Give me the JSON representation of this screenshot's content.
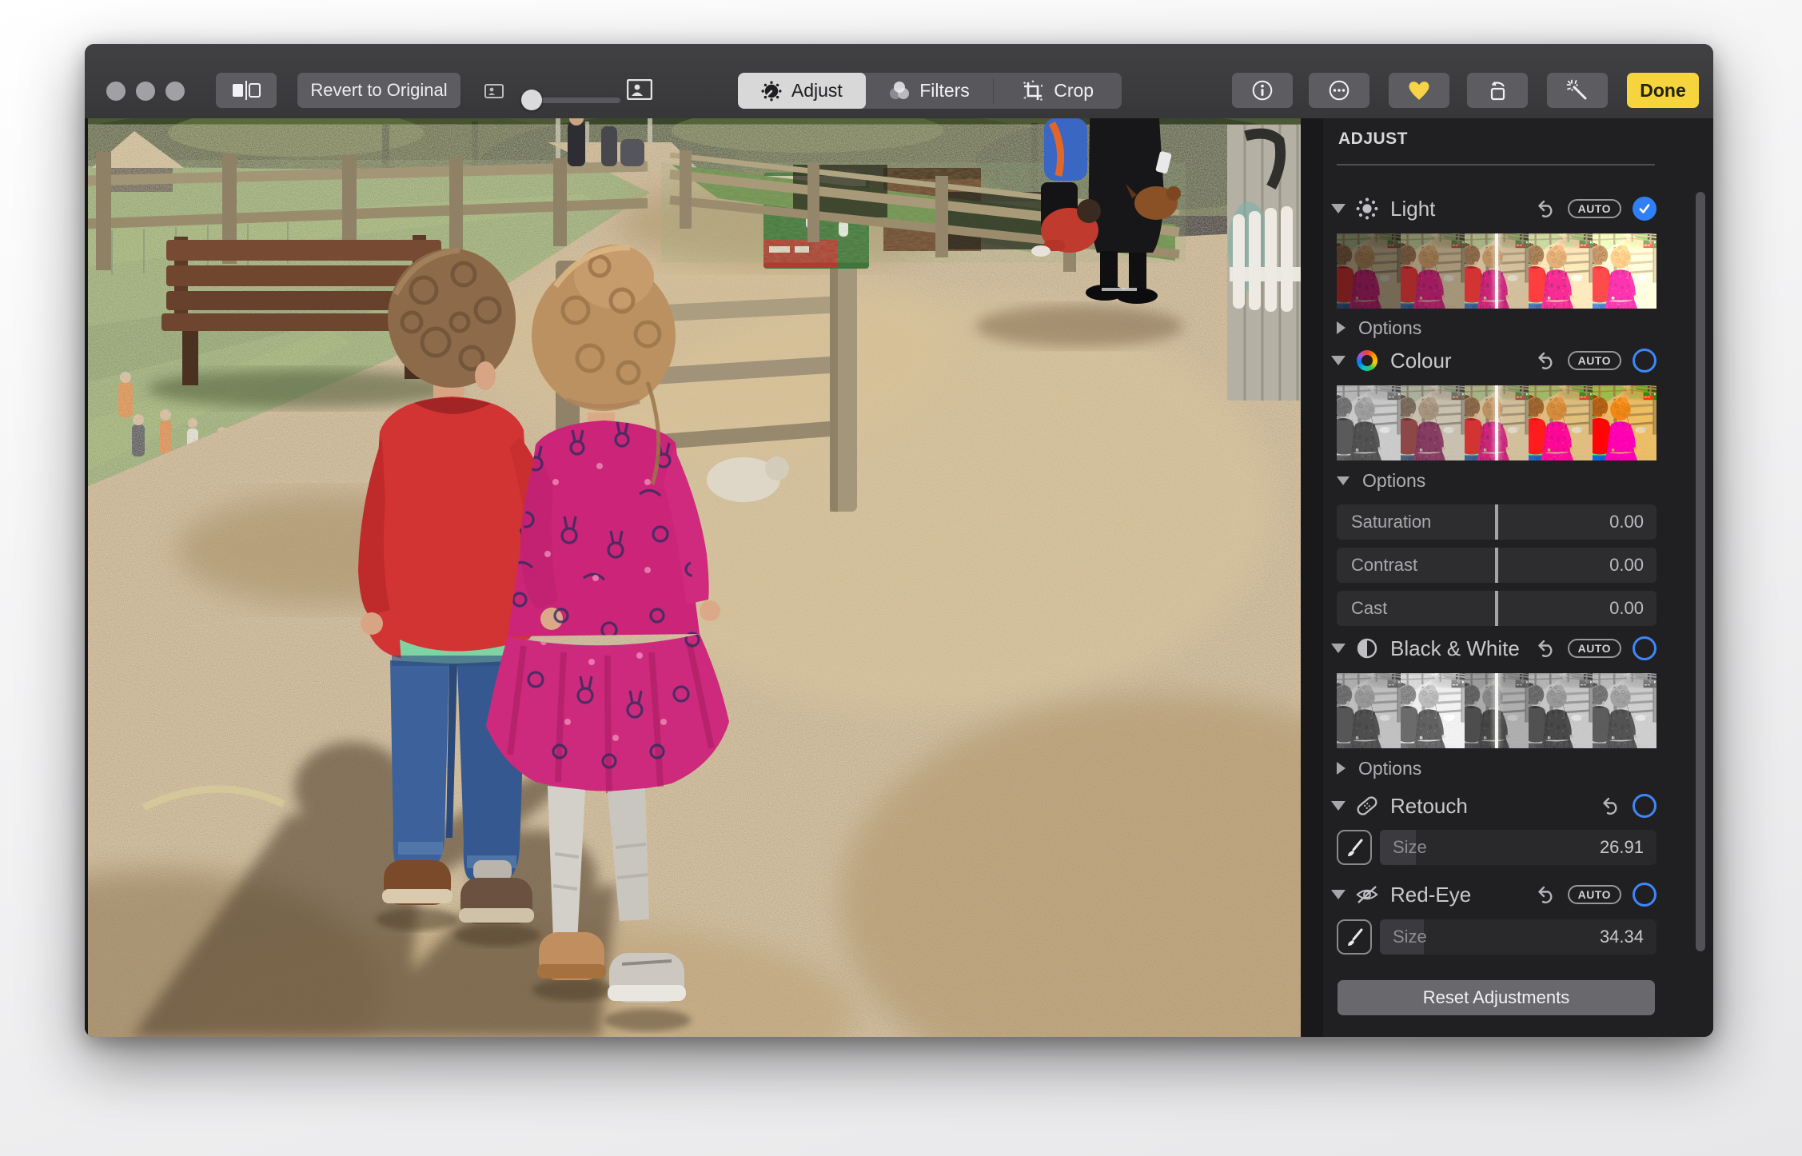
{
  "toolbar": {
    "revert_label": "Revert to Original",
    "segments": [
      {
        "label": "Adjust"
      },
      {
        "label": "Filters"
      },
      {
        "label": "Crop"
      }
    ],
    "done_label": "Done"
  },
  "sidebar": {
    "title": "ADJUST",
    "auto_label": "AUTO",
    "options_label": "Options",
    "light": {
      "label": "Light",
      "enabled": true
    },
    "colour": {
      "label": "Colour",
      "sliders": [
        {
          "label": "Saturation",
          "value": "0.00"
        },
        {
          "label": "Contrast",
          "value": "0.00"
        },
        {
          "label": "Cast",
          "value": "0.00"
        }
      ]
    },
    "black_white": {
      "label": "Black & White"
    },
    "retouch": {
      "label": "Retouch",
      "size_label": "Size",
      "size_value": "26.91"
    },
    "red_eye": {
      "label": "Red-Eye",
      "size_label": "Size",
      "size_value": "34.34"
    },
    "reset_label": "Reset Adjustments"
  },
  "colors": {
    "accent_blue": "#2f7ff7",
    "done_yellow": "#f6d43e",
    "heart_yellow": "#f7d348",
    "light_strip_indicator": "#f6f5f0"
  }
}
